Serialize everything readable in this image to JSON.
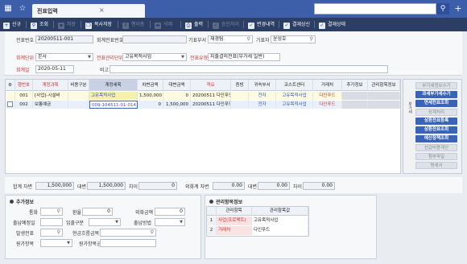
{
  "app": {
    "tab_title": "전표입력",
    "search_placeholder": ""
  },
  "toolbar": {
    "items": [
      {
        "label": "신규",
        "icon": "plus-icon",
        "enabled": true
      },
      {
        "label": "조회",
        "icon": "search-icon",
        "enabled": true
      },
      {
        "label": "저장",
        "icon": "save-icon",
        "enabled": false
      },
      {
        "label": "복사저장",
        "icon": "copy-save-icon",
        "enabled": true
      },
      {
        "label": "행이동",
        "icon": "row-move-icon",
        "enabled": false
      },
      {
        "label": "삭제",
        "icon": "trash-icon",
        "enabled": false
      },
      {
        "label": "출력",
        "icon": "print-icon",
        "enabled": true
      },
      {
        "label": "승인처리",
        "icon": "approve-icon",
        "enabled": false
      },
      {
        "label": "변경내역",
        "icon": "history-icon",
        "enabled": true
      },
      {
        "label": "결재상신",
        "icon": "submit-icon",
        "enabled": true
      },
      {
        "label": "결재상태",
        "icon": "status-icon",
        "enabled": true
      }
    ]
  },
  "header": {
    "voucher_no_label": "전표번호",
    "voucher_no": "20200511-001",
    "account_voucher_label": "회계전표번호",
    "account_voucher": "",
    "dept_label": "기표부서",
    "dept": "재경팀",
    "writer_label": "기표자",
    "writer": "윤성호",
    "unit_label": "회계단위",
    "unit": "본사",
    "mgmt_unit_label": "전표관리단위",
    "mgmt_unit": "고유목적사업",
    "voucher_type_label": "전표유형",
    "voucher_type": "지출결의전표(부가세 일반)",
    "account_date_label": "회계일",
    "account_date": "2020-05-11",
    "memo_label": "비고",
    "memo": ""
  },
  "grid": {
    "columns": [
      "행번호",
      "계정과목",
      "비용구분",
      "계정세목",
      "차변금액",
      "대변금액",
      "적요",
      "증빙",
      "귀속부서",
      "코스트센터",
      "거래처",
      "추가정보",
      "관리항목정보"
    ],
    "rows": [
      {
        "no": "001",
        "account": "[사업]-시설비",
        "cost_type": "",
        "sub_account": "고유목적사업",
        "debit": "1,500,000",
        "credit": "0",
        "summary": "20200511 다인푸드",
        "evidence": "",
        "dept": "전자",
        "cost_center": "고유목적사업",
        "vendor": "다인푸드"
      },
      {
        "no": "002",
        "account": "보통예금",
        "cost_type": "",
        "sub_account": "009-104511-01-014",
        "debit": "0",
        "credit": "1,500,000",
        "summary": "20200511 다인푸드",
        "evidence": "",
        "dept": "전자",
        "cost_center": "고유목적사업",
        "vendor": "다인푸드"
      }
    ]
  },
  "side": {
    "tab_label": "부가세",
    "buttons": [
      {
        "label": "부가세정보수기",
        "on": false
      },
      {
        "label": "과세부가세수기",
        "on": true
      },
      {
        "label": "면세전표조회",
        "on": true
      },
      {
        "label": "상계처리",
        "on": false
      },
      {
        "label": "상환전표등록",
        "on": true
      },
      {
        "label": "상환전표조회",
        "on": true
      },
      {
        "label": "예산정책조회",
        "on": true
      },
      {
        "label": "선급비용계산",
        "on": false
      },
      {
        "label": "첨부파일",
        "on": false
      },
      {
        "label": "명세서",
        "on": false
      }
    ]
  },
  "totals": {
    "group_debit_label": "합계 차변",
    "group_debit": "1,500,000",
    "group_credit_label": "대변",
    "group_credit": "1,500,000",
    "group_diff_label": "차이",
    "group_diff": "0",
    "fx_debit_label": "외화계 차변",
    "fx_debit": "0.00",
    "fx_credit_label": "대변",
    "fx_credit": "0.00",
    "fx_diff_label": "차이",
    "fx_diff": "0.00"
  },
  "extra": {
    "title": "추가정보",
    "currency_label": "통화",
    "rate_label": "환율",
    "rate": "0",
    "fx_amount_label": "외화금액",
    "fx_amount": "0",
    "payment_date_label": "출납예정일",
    "payment_type_label": "입출구분",
    "payment_method_label": "출납방법",
    "issue_label": "발생전표",
    "bill_label": "현금흐름금목",
    "sub_label": "원가항목",
    "cost_label": "원가항목군"
  },
  "mgmt": {
    "title": "관리항목정보",
    "columns": [
      "관리항목",
      "관리항목값"
    ],
    "rows": [
      {
        "no": "1",
        "item": "사업(프로젝트)",
        "value": "고유목적사업"
      },
      {
        "no": "2",
        "item": "거래처",
        "value": "다인푸드"
      }
    ]
  },
  "colors": {
    "topbar": "#3d5ea8",
    "toolbar": "#2c3e63",
    "accent": "#3a64b8",
    "required": "#cc3333"
  }
}
